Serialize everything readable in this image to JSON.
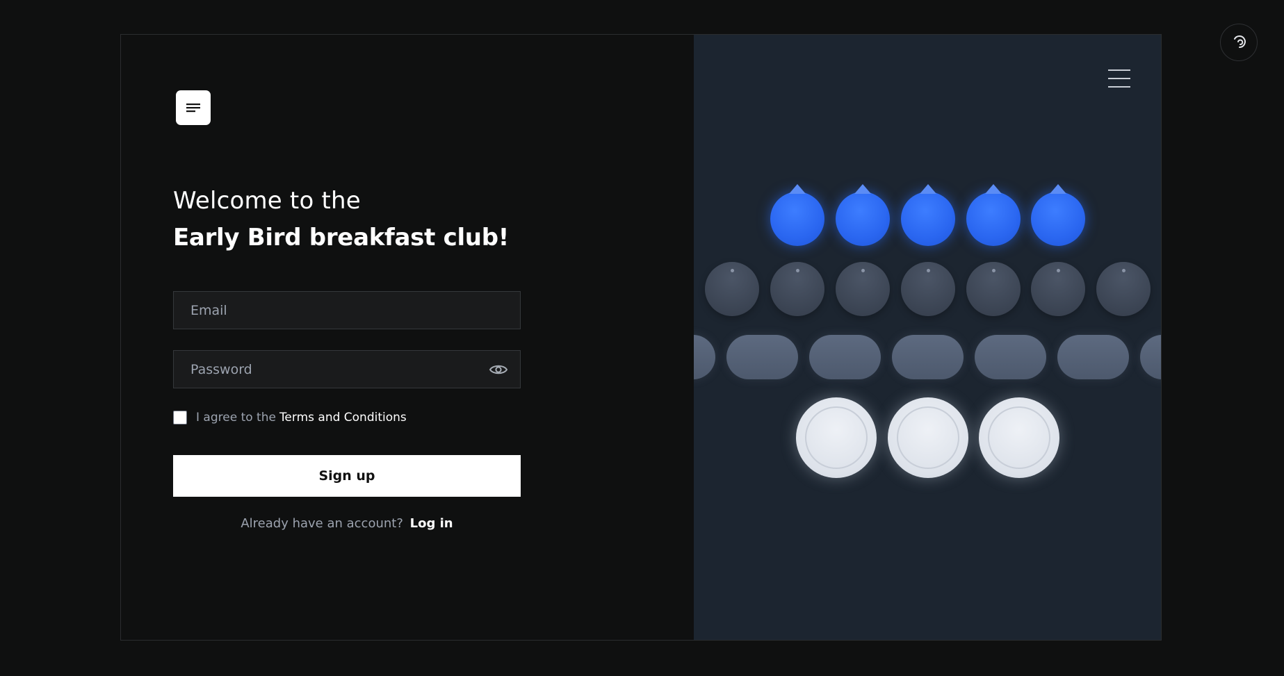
{
  "headline": {
    "line1": "Welcome to the",
    "line2": "Early Bird breakfast club!"
  },
  "form": {
    "email_placeholder": "Email",
    "password_placeholder": "Password",
    "agree_prefix": "I agree to the",
    "terms_link": "Terms and Conditions",
    "signup_label": "Sign up",
    "login_prompt": "Already have an account?",
    "login_link": "Log in"
  },
  "icons": {
    "logo": "menu-lines-icon",
    "password_toggle": "eye-icon",
    "menu": "hamburger-menu-icon",
    "corner": "rotate-icon"
  },
  "illustration": {
    "blue_drops": 5,
    "gray_bowls": 7,
    "pills": 7,
    "plates": 3
  },
  "colors": {
    "page_bg": "#0f1010",
    "panel_bg": "#1c2530",
    "accent_blue": "#2a66f0",
    "button_bg": "#ffffff"
  }
}
